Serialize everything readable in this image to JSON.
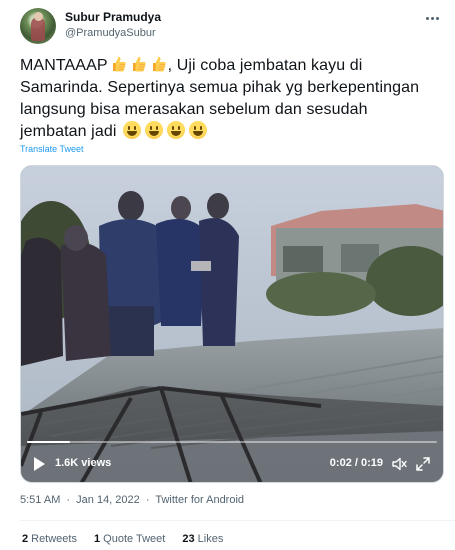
{
  "user": {
    "name": "Subur Pramudya",
    "handle": "@PramudyaSubur"
  },
  "tweet": {
    "line1": "MANTAAAP",
    "line1_tail": ", Uji coba jembatan kayu di",
    "line2": "Samarinda. Sepertinya semua pihak yg berkepentingan",
    "line3": "langsung bisa merasakan sebelum dan sesudah",
    "line4": "jembatan jadi",
    "thumbs_emoji_count": 3,
    "smile_emoji_count": 4,
    "translate_label": "Translate Tweet"
  },
  "video": {
    "views": "1.6K views",
    "time": "0:02 / 0:19",
    "progress_fraction": 0.105
  },
  "meta": {
    "time": "5:51 AM",
    "date": "Jan 14, 2022",
    "separator": "·",
    "source": "Twitter for Android"
  },
  "stats": {
    "retweets_count": "2",
    "retweets_label": "Retweets",
    "quotes_count": "1",
    "quotes_label": "Quote Tweet",
    "likes_count": "23",
    "likes_label": "Likes"
  },
  "colors": {
    "link": "#1d9bf0",
    "text": "#0f1419",
    "secondary": "#536471"
  },
  "icons": [
    "more-icon",
    "thumbs-up-icon",
    "smile-icon",
    "play-icon",
    "volume-icon",
    "fullscreen-icon"
  ]
}
